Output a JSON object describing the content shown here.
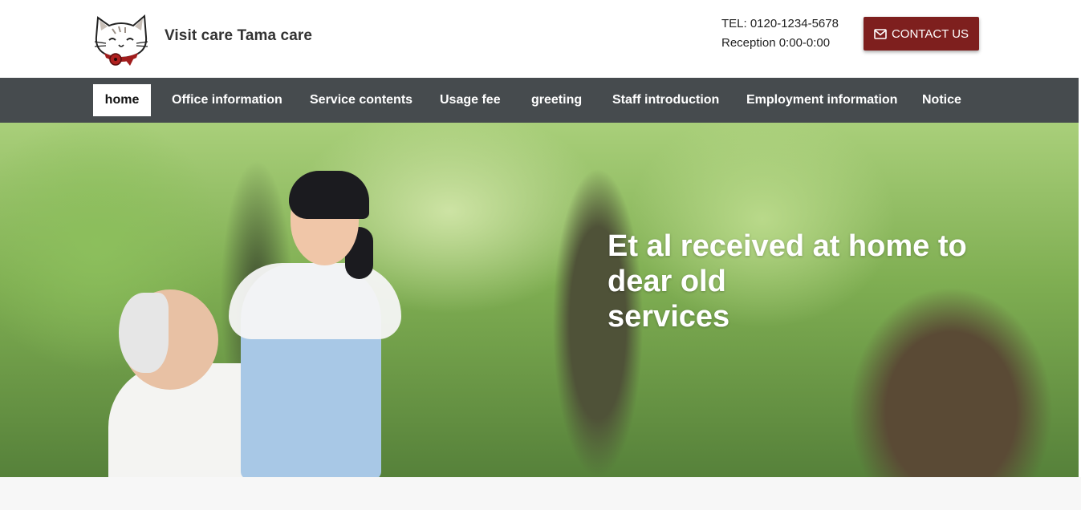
{
  "header": {
    "logo_icon": "cat-logo-icon",
    "site_title": "Visit care Tama care",
    "tel": "TEL: 0120-1234-5678",
    "reception": "Reception 0:00-0:00",
    "contact_button": {
      "icon": "envelope-icon",
      "label": "CONTACT US",
      "color": "#7e1f1e"
    }
  },
  "nav": {
    "background": "#464b4e",
    "items": [
      {
        "label": "home",
        "active": true
      },
      {
        "label": "Office information"
      },
      {
        "label": "Service contents"
      },
      {
        "label": "Usage fee"
      },
      {
        "label": "greeting"
      },
      {
        "label": "Staff introduction"
      },
      {
        "label": "Employment information"
      },
      {
        "label": "Notice"
      }
    ]
  },
  "hero": {
    "headline_lines": [
      "Et al received at home to",
      "dear old",
      "services"
    ]
  }
}
